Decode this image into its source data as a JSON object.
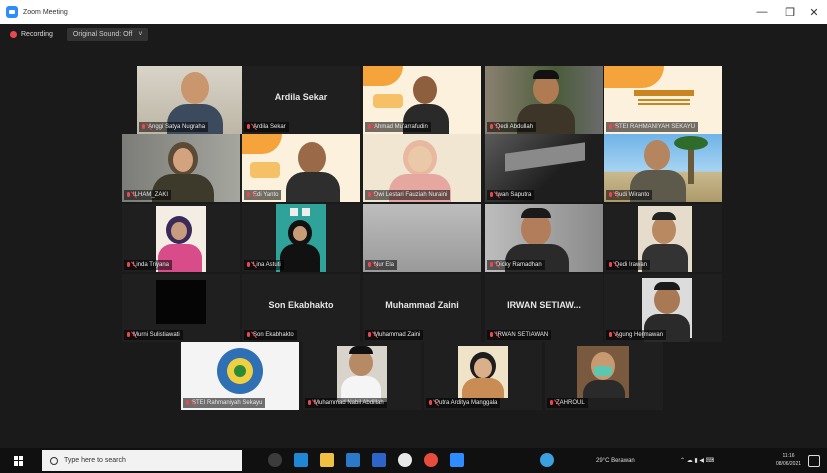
{
  "window": {
    "title": "Zoom Meeting",
    "minimize": "—",
    "restore": "❒",
    "close": "✕"
  },
  "toolbar": {
    "recording_label": "Recording",
    "view_label": "Original Sound: Off",
    "view_caret": "˅"
  },
  "participants": [
    {
      "name": "Anggi Satya Nugraha",
      "center_name": ""
    },
    {
      "name": "Ardila Sekar",
      "center_name": "Ardila Sekar"
    },
    {
      "name": "Ahmad Mu'arrafudin",
      "center_name": ""
    },
    {
      "name": "Dedi Abdullah",
      "center_name": ""
    },
    {
      "name": "STEI RAHMANIYAH SEKAYU",
      "center_name": ""
    },
    {
      "name": "ILHAM_ZAKI",
      "center_name": ""
    },
    {
      "name": "Edi Yanto",
      "center_name": ""
    },
    {
      "name": "Dwi Lestari Fauziah Nuraini",
      "center_name": ""
    },
    {
      "name": "Iwan Saputra",
      "center_name": ""
    },
    {
      "name": "Budi Wiranto",
      "center_name": ""
    },
    {
      "name": "Linda Triyana",
      "center_name": ""
    },
    {
      "name": "Lina Astuti",
      "center_name": ""
    },
    {
      "name": "Nur Ela",
      "center_name": ""
    },
    {
      "name": "Dicky Ramadhan",
      "center_name": ""
    },
    {
      "name": "Dedi Irawan",
      "center_name": ""
    },
    {
      "name": "Murni Sulistiawati",
      "center_name": ""
    },
    {
      "name": "Son Ekabhakto",
      "center_name": "Son Ekabhakto"
    },
    {
      "name": "Muhammad Zaini",
      "center_name": "Muhammad Zaini"
    },
    {
      "name": "IRWAN SETIAWAN",
      "center_name": "IRWAN SETIAW..."
    },
    {
      "name": "Agung Hermawan",
      "center_name": ""
    },
    {
      "name": "STEI Rahmaniyah Sekayu",
      "center_name": ""
    },
    {
      "name": "Muhammad Nabil Abdillah",
      "center_name": ""
    },
    {
      "name": "Putra Arditya Manggala",
      "center_name": ""
    },
    {
      "name": "ZAHROUL",
      "center_name": ""
    }
  ],
  "taskbar": {
    "search_placeholder": "Type here to search",
    "weather": "29°C Berawan",
    "tray_symbols": "⌃ ☁ ▮ ◀ ⌨",
    "time": "11:16",
    "date": "08/06/2021"
  }
}
